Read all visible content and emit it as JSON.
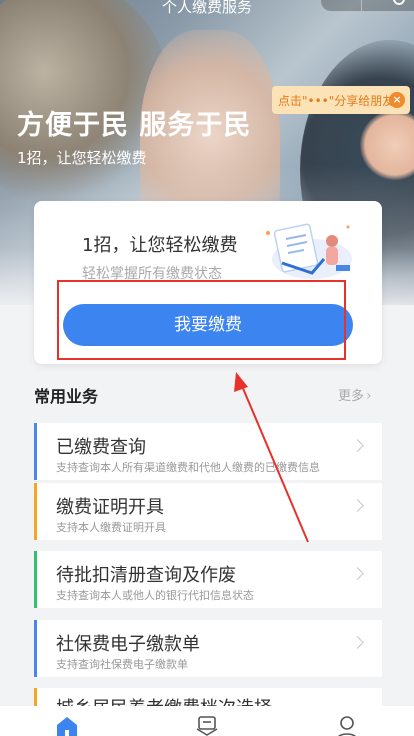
{
  "status_bar": {
    "title": "个人缴费服务"
  },
  "hero": {
    "title": "方便于民 服务于民",
    "subtitle": "1招，让您轻松缴费"
  },
  "share_tip": {
    "text": "点击\"•••\"分享给朋友",
    "close_icon": "close-icon"
  },
  "card": {
    "title": "1招，让您轻松缴费",
    "subtitle": "轻松掌握所有缴费状态",
    "button_label": "我要缴费"
  },
  "section": {
    "title": "常用业务",
    "more_label": "更多"
  },
  "items": [
    {
      "title": "已缴费查询",
      "desc": "支持查询本人所有渠道缴费和代他人缴费的已缴费信息",
      "bar_color": "#4a86e8"
    },
    {
      "title": "缴费证明开具",
      "desc": "支持本人缴费证明开具",
      "bar_color": "#f5a623"
    },
    {
      "title": "待批扣清册查询及作废",
      "desc": "支持查询本人或他人的银行代扣信息状态",
      "bar_color": "#34c06f"
    },
    {
      "title": "社保费电子缴款单",
      "desc": "支持查询社保费电子缴款单",
      "bar_color": "#4a86e8"
    },
    {
      "title": "城乡居民养老缴费档次选择",
      "desc": "",
      "bar_color": "#f5a623"
    }
  ],
  "colors": {
    "accent": "#3c84f0",
    "annotation": "#e8312a"
  },
  "bottom_nav": {
    "icons": [
      "home-icon",
      "bill-icon",
      "user-icon"
    ]
  }
}
